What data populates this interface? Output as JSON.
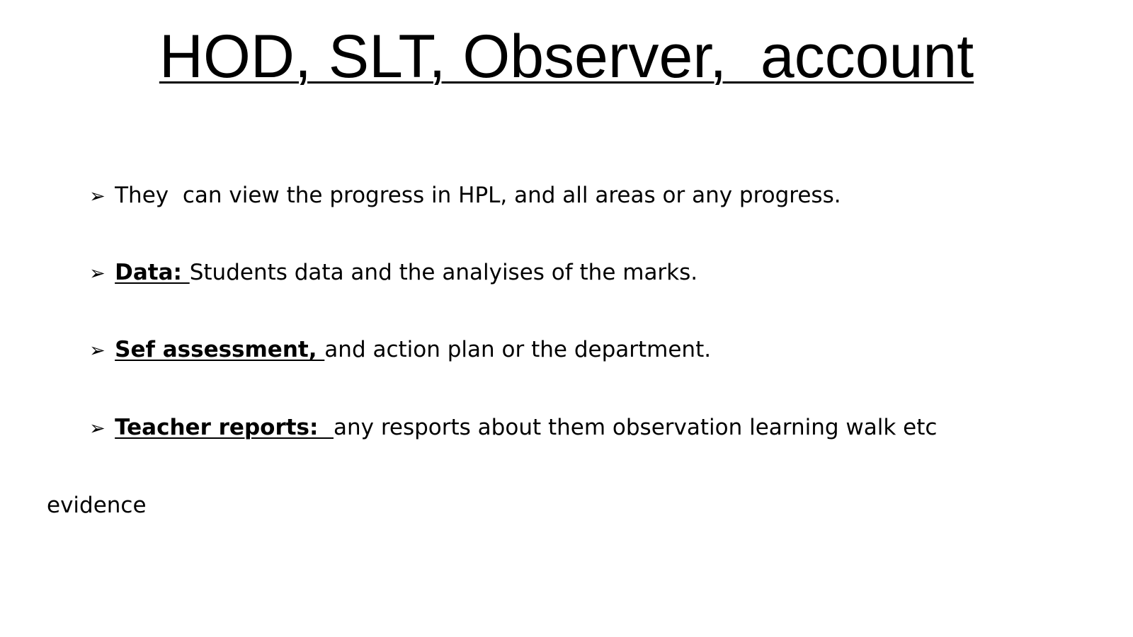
{
  "slide": {
    "title": "HOD, SLT, Observer,  account",
    "bullet_symbol": "➢",
    "bullets": [
      {
        "term": "",
        "text": "They  can view the progress in HPL, and all areas or any progress."
      },
      {
        "term": "Data: ",
        "text": "Students data and the analyises of the marks."
      },
      {
        "term": "Sef assessment, ",
        "text": "and action plan or the department."
      },
      {
        "term": "Teacher reports:  ",
        "text": "any resports about them observation learning walk etc",
        "continuation": "evidence"
      }
    ]
  }
}
